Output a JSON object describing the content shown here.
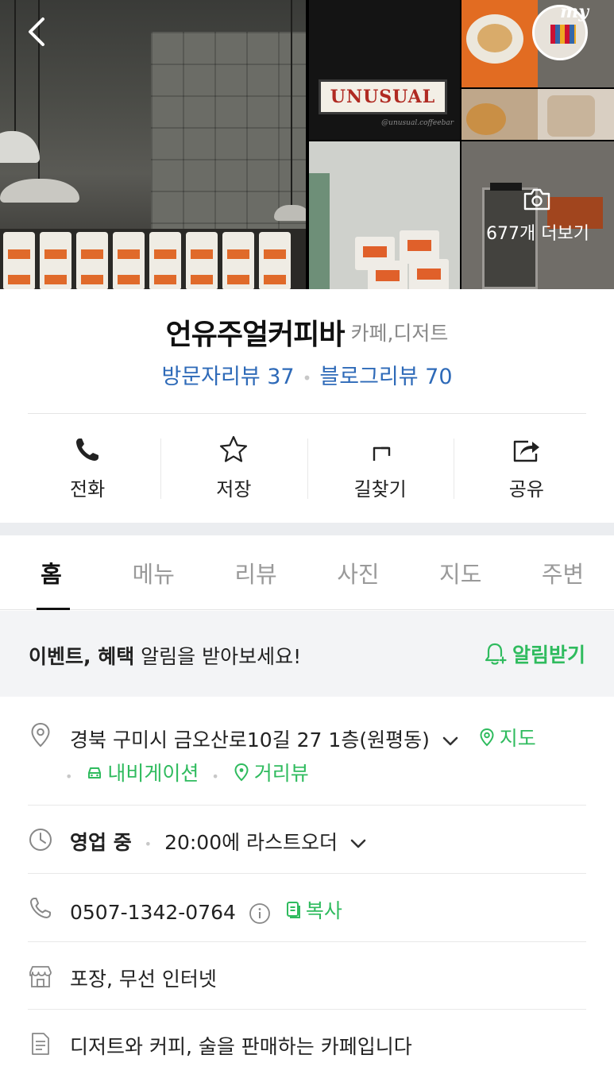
{
  "gallery": {
    "sign_text": "UNUSUAL",
    "sign_subtext": "@unusual.coffeebar",
    "my_label": "my",
    "more_photos_label": "677개 더보기"
  },
  "place": {
    "name": "언유주얼커피바",
    "category": "카페,디저트",
    "visitor_reviews": "방문자리뷰 37",
    "blog_reviews": "블로그리뷰 70"
  },
  "actions": [
    {
      "label": "전화",
      "icon": "phone-icon"
    },
    {
      "label": "저장",
      "icon": "star-icon"
    },
    {
      "label": "길찾기",
      "icon": "directions-icon"
    },
    {
      "label": "공유",
      "icon": "share-icon"
    }
  ],
  "tabs": [
    "홈",
    "메뉴",
    "리뷰",
    "사진",
    "지도",
    "주변"
  ],
  "active_tab": "홈",
  "banner": {
    "bold": "이벤트, 혜택",
    "rest": " 알림을 받아보세요!",
    "button": "알림받기"
  },
  "info": {
    "address": "경북 구미시 금오산로10길 27 1층(원평동)",
    "map_link": "지도",
    "navigation_link": "내비게이션",
    "street_view_link": "거리뷰",
    "hours_status": "영업 중",
    "hours_detail": "20:00에 라스트오더",
    "phone": "0507-1342-0764",
    "copy_label": "복사",
    "amenities": "포장, 무선 인터넷",
    "description": "디저트와 커피, 술을 판매하는 카페입니다"
  },
  "colors": {
    "accent_green": "#2fbb5e",
    "review_blue": "#2e6ab8"
  }
}
